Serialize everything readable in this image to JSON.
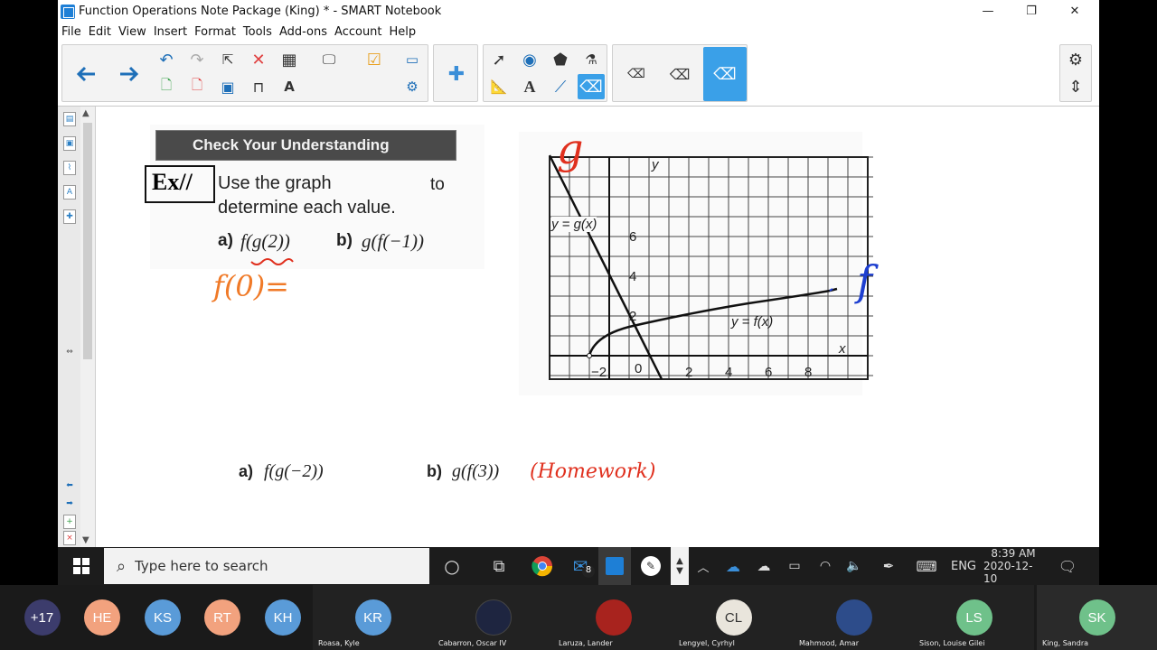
{
  "window": {
    "title": "Function Operations Note Package (King) * - SMART Notebook",
    "minimize": "—",
    "restore": "❐",
    "close": "✕"
  },
  "menu": [
    "File",
    "Edit",
    "View",
    "Insert",
    "Format",
    "Tools",
    "Add-ons",
    "Account",
    "Help"
  ],
  "toolbar": {
    "back_icon": "arrow-left-icon",
    "forward_icon": "arrow-right-icon",
    "selected_tool": "eraser"
  },
  "page": {
    "banner": "Check Your Understanding",
    "ex_label": "Ex//",
    "instruction_line1": "Use the graph",
    "instruction_to": "to",
    "instruction_line2": "determine each value.",
    "qa_label": "a)",
    "qa_expr": "f(g(2))",
    "qb_label": "b)",
    "qb_expr": "g(f(−1))",
    "handwritten_work": "f(0)=",
    "hw_a_label": "a)",
    "hw_a_expr": "f(g(−2))",
    "hw_b_label": "b)",
    "hw_b_expr": "g(f(3))",
    "homework_note": "(Homework)"
  },
  "graph": {
    "g_label": "y = g(x)",
    "f_label": "y = f(x)",
    "y_axis": "y",
    "x_axis": "x",
    "handwritten_g": "g",
    "handwritten_f": "f",
    "x_ticks": [
      "−2",
      "0",
      "2",
      "4",
      "6",
      "8"
    ],
    "y_ticks": [
      "2",
      "4",
      "6"
    ]
  },
  "taskbar": {
    "search_placeholder": "Type here to search",
    "mail_badge": "8",
    "lang": "ENG",
    "time": "8:39 AM",
    "date": "2020-12-10"
  },
  "participants": {
    "more": "+17",
    "tiles": [
      {
        "initials": "HE",
        "name": "",
        "color": "#f2a27e"
      },
      {
        "initials": "KS",
        "name": "",
        "color": "#5a9bd8"
      },
      {
        "initials": "RT",
        "name": "",
        "color": "#f2a27e"
      },
      {
        "initials": "KH",
        "name": "",
        "color": "#5a9bd8"
      },
      {
        "initials": "KR",
        "name": "Roasa, Kyle",
        "color": "#5a9bd8"
      },
      {
        "initials": "",
        "name": "Cabarron, Oscar IV",
        "color": "#1e2540"
      },
      {
        "initials": "",
        "name": "Laruza, Lander",
        "color": "#a8231e"
      },
      {
        "initials": "CL",
        "name": "Lengyel, Cyrhyl",
        "color": "#e9e5dc"
      },
      {
        "initials": "",
        "name": "Mahmood, Amar",
        "color": "#2d4c8a"
      },
      {
        "initials": "LS",
        "name": "Sison, Louise Gilei",
        "color": "#6fc18a"
      },
      {
        "initials": "SK",
        "name": "King, Sandra",
        "color": "#6fc18a"
      }
    ]
  }
}
